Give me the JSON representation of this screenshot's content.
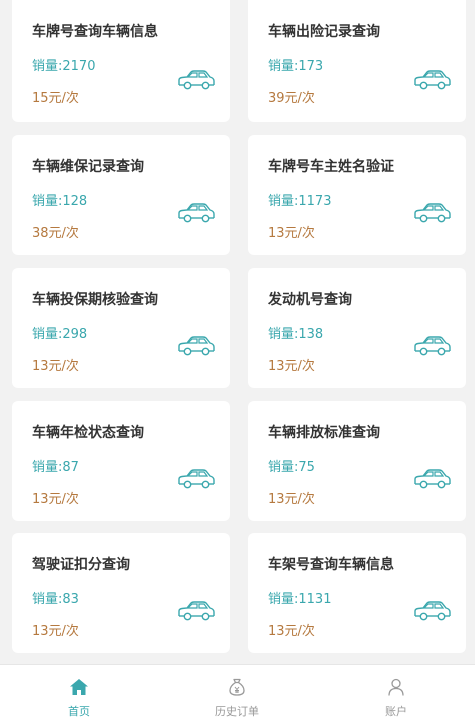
{
  "cards": [
    {
      "title": "车牌号查询车辆信息",
      "sales": "销量:2170",
      "price": "15元/次"
    },
    {
      "title": "车辆出险记录查询",
      "sales": "销量:173",
      "price": "39元/次"
    },
    {
      "title": "车辆维保记录查询",
      "sales": "销量:128",
      "price": "38元/次"
    },
    {
      "title": "车牌号车主姓名验证",
      "sales": "销量:1173",
      "price": "13元/次"
    },
    {
      "title": "车辆投保期核验查询",
      "sales": "销量:298",
      "price": "13元/次"
    },
    {
      "title": "发动机号查询",
      "sales": "销量:138",
      "price": "13元/次"
    },
    {
      "title": "车辆年检状态查询",
      "sales": "销量:87",
      "price": "13元/次"
    },
    {
      "title": "车辆排放标准查询",
      "sales": "销量:75",
      "price": "13元/次"
    },
    {
      "title": "驾驶证扣分查询",
      "sales": "销量:83",
      "price": "13元/次"
    },
    {
      "title": "车架号查询车辆信息",
      "sales": "销量:1131",
      "price": "13元/次"
    }
  ],
  "tabbar": {
    "home": "首页",
    "history": "历史订单",
    "account": "账户"
  },
  "colors": {
    "accent": "#3aa7ad",
    "price": "#b5793f",
    "icon_inactive": "#999999"
  },
  "icons": {
    "card": "car-icon",
    "home": "home-icon",
    "history": "money-bag-icon",
    "account": "person-icon"
  }
}
